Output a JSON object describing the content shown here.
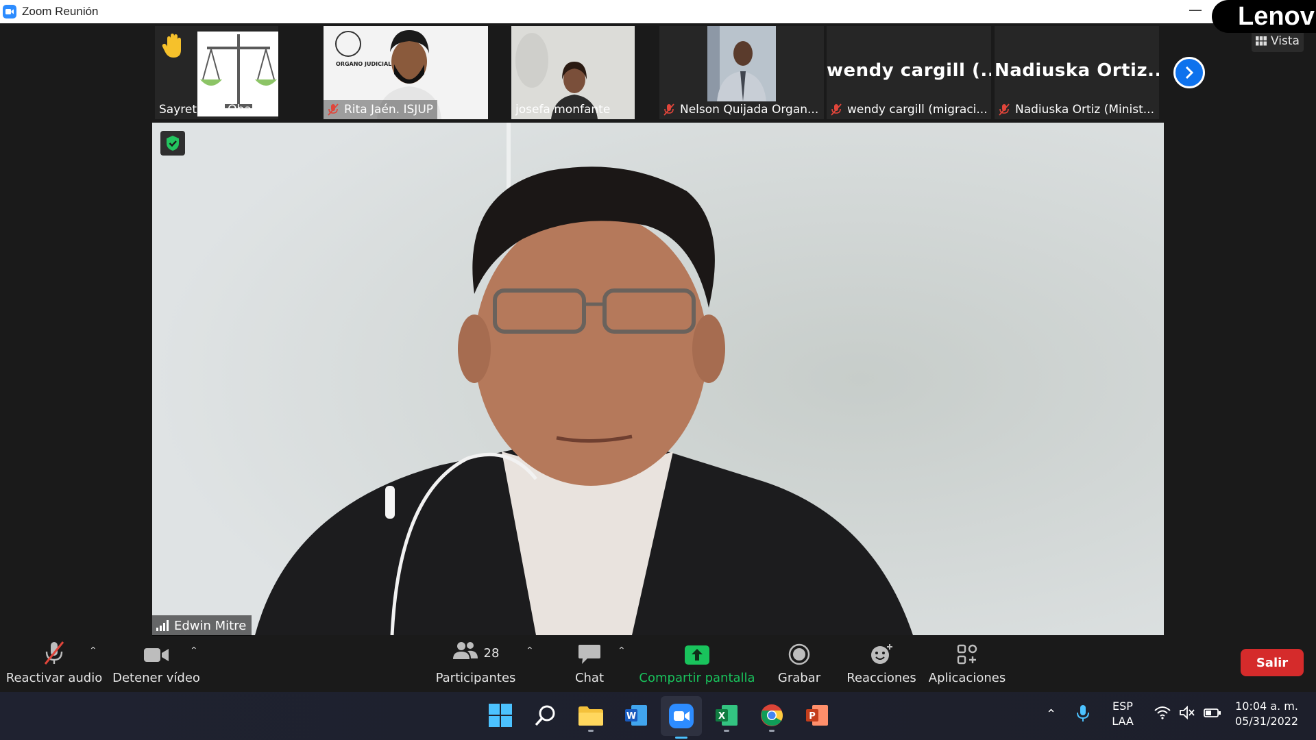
{
  "window": {
    "title": "Zoom Reunión",
    "brand_overlay": "Lenov"
  },
  "view_button": {
    "label": "Vista"
  },
  "thumbnails": [
    {
      "name": "Sayreth De Obaldia",
      "muted": false,
      "hand_raised": true
    },
    {
      "name": "Rita Jaén. ISJUP",
      "muted": true
    },
    {
      "name": "josefa monfante",
      "muted": false
    },
    {
      "name": "Nelson Quijada Organ...",
      "muted": true
    },
    {
      "name": "wendy cargill (migraci...",
      "muted": true,
      "display_name": "wendy cargill (..."
    },
    {
      "name": "Nadiuska Ortiz (Minist...",
      "muted": true,
      "display_name": "Nadiuska Ortiz..."
    }
  ],
  "thumb_logo_text": "ORGANO JUDICIAL",
  "main_speaker": {
    "name": "Edwin Mitre"
  },
  "toolbar": {
    "unmute_label": "Reactivar audio",
    "stop_video_label": "Detener vídeo",
    "participants_label": "Participantes",
    "participants_count": "28",
    "chat_label": "Chat",
    "share_label": "Compartir pantalla",
    "record_label": "Grabar",
    "reactions_label": "Reacciones",
    "apps_label": "Aplicaciones",
    "leave_label": "Salir"
  },
  "taskbar": {
    "language_top": "ESP",
    "language_bottom": "LAA",
    "time": "10:04 a. m.",
    "date": "05/31/2022"
  },
  "colors": {
    "zoom_blue": "#0e72ed",
    "share_green": "#19c35c",
    "leave_red": "#d52b2b",
    "mute_red": "#e0453a"
  }
}
